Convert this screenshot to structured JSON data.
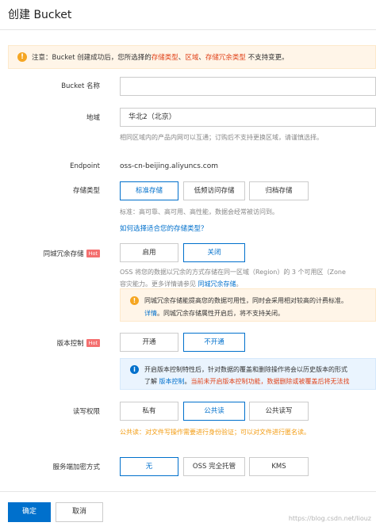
{
  "header": {
    "title": "创建 Bucket"
  },
  "notice": {
    "prefix": "注意：Bucket 创建成功后，您所选择的",
    "h1": "存储类型",
    "sep1": "、",
    "h2": "区域",
    "sep2": "、",
    "h3": "存储冗余类型",
    "suffix": "不支持变更。"
  },
  "bucket_name": {
    "label": "Bucket 名称",
    "value": ""
  },
  "region": {
    "label": "地域",
    "value": "华北2（北京）",
    "hint": "相同区域内的产品内网可以互通；订购后不支持更换区域，请谨慎选择。"
  },
  "endpoint": {
    "label": "Endpoint",
    "value": "oss-cn-beijing.aliyuncs.com"
  },
  "storage_class": {
    "label": "存储类型",
    "options": [
      "标准存储",
      "低频访问存储",
      "归档存储"
    ],
    "selected": "标准存储",
    "hint": "标准：高可靠、高可用、高性能，数据会经常被访问到。",
    "link": "如何选择适合您的存储类型？"
  },
  "redundancy": {
    "label": "同城冗余存储",
    "hot": "Hot",
    "options": [
      "启用",
      "关闭"
    ],
    "selected": "关闭",
    "desc1": "OSS 将您的数据以冗余的方式存储在同一区域（Region）的 3 个可用区（Zone",
    "desc2_prefix": "容灾能力。更多详情请参见",
    "desc2_link": "同城冗余存储",
    "desc2_suffix": "。",
    "tip_l1": "同城冗余存储能提高您的数据可用性，同时会采用相对较高的计费标准。",
    "tip_l2_link": "详情",
    "tip_l2_suffix": "。同城冗余存储属性开启后，将不支持关闭。"
  },
  "versioning": {
    "label": "版本控制",
    "hot": "Hot",
    "options": [
      "开通",
      "不开通"
    ],
    "selected": "不开通",
    "tip_l1": "开启版本控制特性后，针对数据的覆盖和删除操作将会以历史版本的形式",
    "tip_l2_prefix": "了解",
    "tip_l2_link": "版本控制",
    "tip_l2_mid": "。",
    "tip_l2_red": "当前未开启版本控制功能，数据删除或被覆盖后将无法找"
  },
  "acl": {
    "label": "读写权限",
    "options": [
      "私有",
      "公共读",
      "公共读写"
    ],
    "selected": "公共读",
    "warning": "公共读：对文件写操作需要进行身份验证；可以对文件进行匿名读。"
  },
  "encryption": {
    "label": "服务端加密方式",
    "options": [
      "无",
      "OSS 完全托管",
      "KMS"
    ],
    "selected": "无"
  },
  "footer": {
    "confirm": "确定",
    "cancel": "取消"
  },
  "watermark": "https://blog.csdn.net/liouz",
  "colors": {
    "primary": "#0070cc",
    "warning": "#f5a623",
    "danger": "#e0431a",
    "hot": "#f46f6f"
  }
}
